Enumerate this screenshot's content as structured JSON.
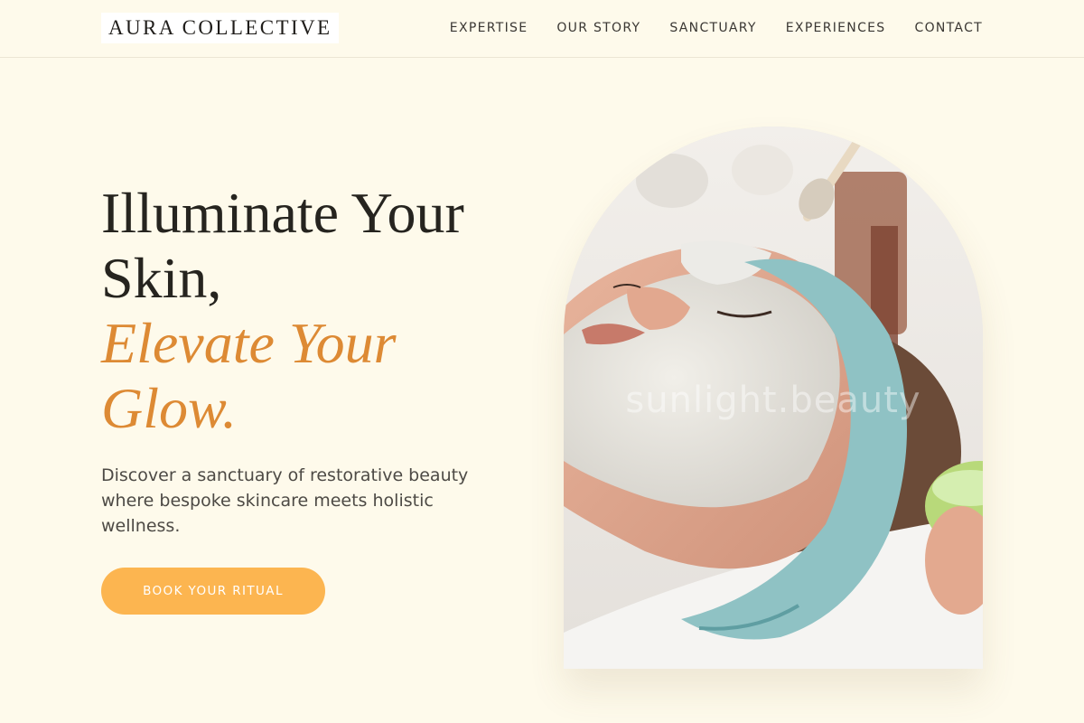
{
  "brand": {
    "logo_text": "AURA COLLECTIVE"
  },
  "nav": {
    "items": [
      {
        "label": "EXPERTISE"
      },
      {
        "label": "OUR STORY"
      },
      {
        "label": "SANCTUARY"
      },
      {
        "label": "EXPERIENCES"
      },
      {
        "label": "CONTACT"
      }
    ]
  },
  "hero": {
    "title_line1": "Illuminate Your",
    "title_line2": "Skin,",
    "title_accent_line1": "Elevate Your",
    "title_accent_line2": "Glow.",
    "subtitle": "Discover a sanctuary of restorative beauty where bespoke skincare meets holistic wellness.",
    "cta_label": "BOOK YOUR RITUAL",
    "image_watermark": "sunlight.beauty",
    "image_subject": "facial-treatment-photo"
  },
  "colors": {
    "background": "#fefaeb",
    "accent": "#dd8a34",
    "button": "#fcb550",
    "text": "#26241f"
  }
}
